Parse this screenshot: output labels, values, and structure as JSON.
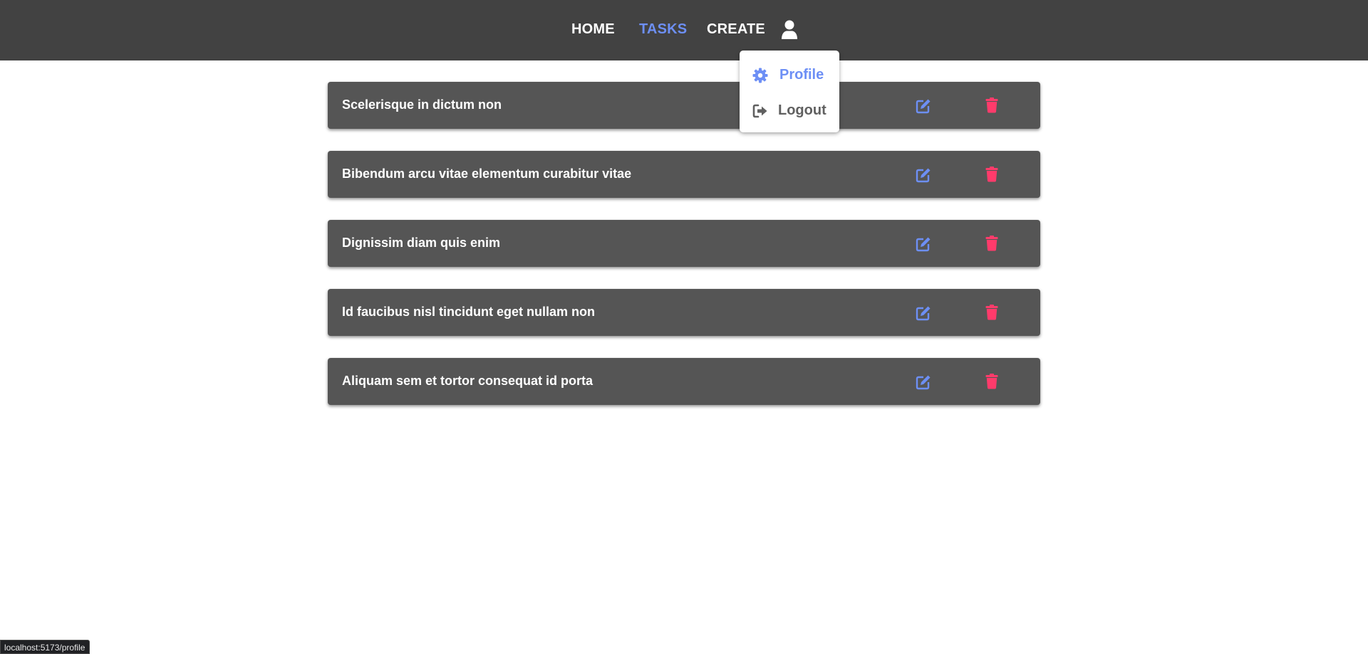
{
  "nav": {
    "home_label": "HOME",
    "tasks_label": "TASKS",
    "create_label": "CREATE",
    "active": "TASKS",
    "user_icon": "user-icon"
  },
  "dropdown": {
    "items": [
      {
        "label": "Profile",
        "icon": "gear-icon"
      },
      {
        "label": "Logout",
        "icon": "logout-icon"
      }
    ]
  },
  "tasks": [
    {
      "title": "Scelerisque in dictum non"
    },
    {
      "title": "Bibendum arcu vitae elementum curabitur vitae"
    },
    {
      "title": "Dignissim diam quis enim"
    },
    {
      "title": "Id faucibus nisl tincidunt eget nullam non"
    },
    {
      "title": "Aliquam sem et tortor consequat id porta"
    }
  ],
  "status_bar": {
    "url": "localhost:5173/profile"
  },
  "colors": {
    "navbar": "#424242",
    "accent": "#6d8ff5",
    "delete": "#ff3b6b",
    "card": "#555555"
  }
}
